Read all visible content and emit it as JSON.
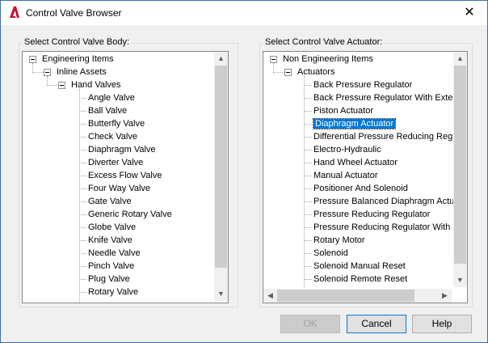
{
  "window": {
    "title": "Control Valve Browser",
    "close_glyph": "✕",
    "app_icon": "autocad-a-icon"
  },
  "body_panel": {
    "label": "Select Control Valve Body:",
    "root": "Engineering Items",
    "level1": "Inline Assets",
    "level2": "Hand Valves",
    "items": [
      "Angle Valve",
      "Ball Valve",
      "Butterfly Valve",
      "Check Valve",
      "Diaphragm Valve",
      "Diverter Valve",
      "Excess Flow Valve",
      "Four Way Valve",
      "Gate Valve",
      "Generic Rotary Valve",
      "Globe Valve",
      "Knife Valve",
      "Needle Valve",
      "Pinch Valve",
      "Plug Valve",
      "Rotary Valve"
    ]
  },
  "actuator_panel": {
    "label": "Select Control Valve Actuator:",
    "root": "Non Engineering Items",
    "level1": "Actuators",
    "selected_index": 3,
    "items": [
      "Back Pressure Regulator",
      "Back Pressure Regulator With Extern",
      "Piston Actuator",
      "Diaphragm Actuator",
      "Differential Pressure Reducing Regul",
      "Electro-Hydraulic",
      "Hand Wheel Actuator",
      "Manual Actuator",
      "Positioner And Solenoid",
      "Pressure Balanced Diaphragm Actua",
      "Pressure Reducing Regulator",
      "Pressure Reducing Regulator With E",
      "Rotary Motor",
      "Solenoid",
      "Solenoid Manual Reset",
      "Solenoid Remote Reset"
    ]
  },
  "buttons": {
    "ok": "OK",
    "cancel": "Cancel",
    "help": "Help"
  },
  "scroll": {
    "up": "▲",
    "down": "▼",
    "left": "◀",
    "right": "▶"
  },
  "colors": {
    "selection": "#0078d7",
    "app_icon": "#c8102e"
  }
}
